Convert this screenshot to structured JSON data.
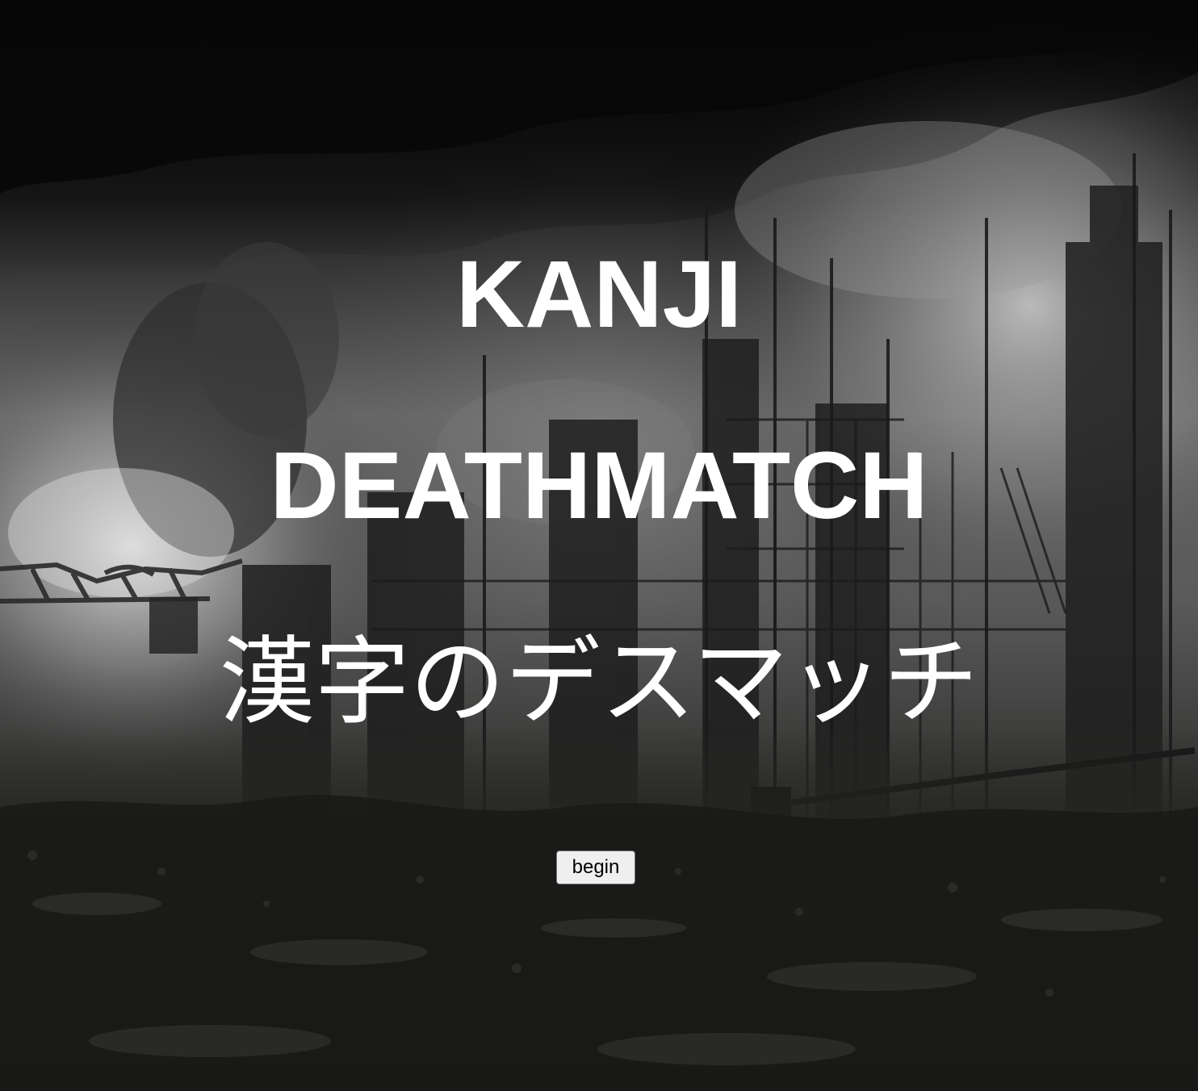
{
  "scene": {
    "background": "ruined-industrial-city-smoke",
    "colors": {
      "title_text": "#ffffff",
      "sky_dark": "#0d0d0d",
      "smoke_light": "#b9b9b9",
      "ground": "#1a1a18"
    }
  },
  "title": {
    "line1": "KANJI",
    "line2": "DEATHMATCH",
    "line3": "漢字のデスマッチ"
  },
  "actions": {
    "begin_label": "begin"
  }
}
